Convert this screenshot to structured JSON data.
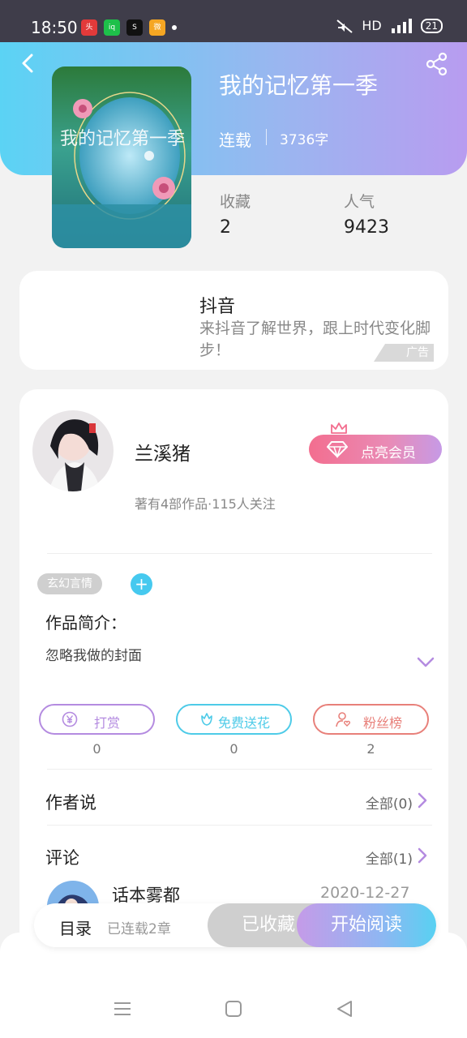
{
  "status_bar": {
    "time": "18:50",
    "network": "HD",
    "battery": "21",
    "apps": [
      "今日头条",
      "爱奇艺",
      "Soul",
      "微博"
    ]
  },
  "book": {
    "title": "我的记忆第一季",
    "status": "连载",
    "word_count": "3736字",
    "cover_text": "我的记忆第一季"
  },
  "stats": {
    "favorites_label": "收藏",
    "favorites_value": "2",
    "popularity_label": "人气",
    "popularity_value": "9423"
  },
  "ad": {
    "title": "抖音",
    "description": "来抖音了解世界，跟上时代变化脚步！",
    "badge": "广告"
  },
  "author": {
    "name": "兰溪猪",
    "meta": "著有4部作品·115人关注",
    "vip_label": "点亮会员"
  },
  "tags": [
    "玄幻言情"
  ],
  "intro": {
    "label": "作品简介：",
    "text": "忽略我做的封面"
  },
  "actions": [
    {
      "label": "打赏",
      "count": "0",
      "color": "#b48be0"
    },
    {
      "label": "免费送花",
      "count": "0",
      "color": "#4ecbe8"
    },
    {
      "label": "粉丝榜",
      "count": "2",
      "color": "#e8807a"
    }
  ],
  "author_says": {
    "label": "作者说",
    "link": "全部(0)"
  },
  "comments": {
    "label": "评论",
    "link": "全部(1)",
    "first": {
      "name": "话本雾都",
      "date": "2020-12-27"
    }
  },
  "bottom_bar": {
    "toc": "目录",
    "serial": "已连载2章",
    "collected": "已收藏",
    "read": "开始阅读"
  },
  "colors": {
    "accent_cyan": "#46c9ef",
    "accent_purple": "#b89cf0",
    "vip_pink": "#f36e8f"
  }
}
